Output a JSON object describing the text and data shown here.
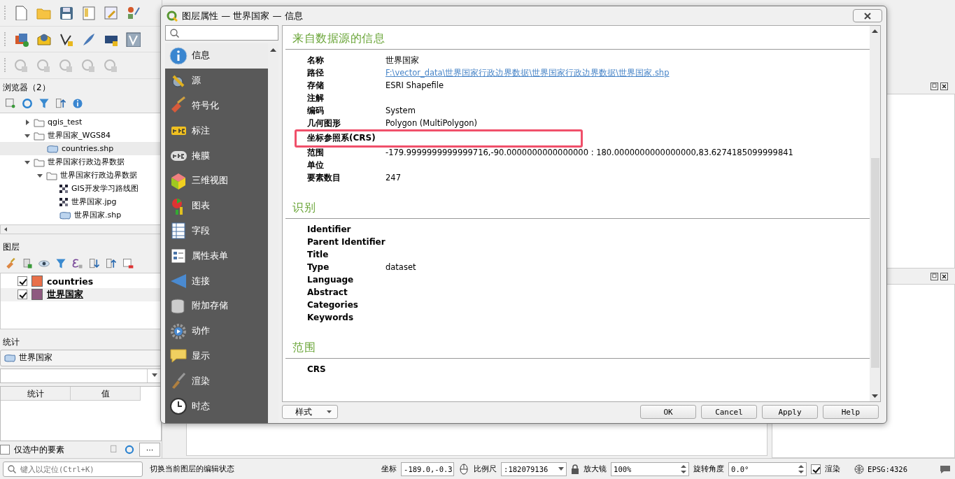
{
  "browser_panel": {
    "title": "浏览器（2）",
    "tree": [
      {
        "label": "qgis_test",
        "kind": "folder",
        "expanded": false,
        "selected": false
      },
      {
        "label": "世界国家_WGS84",
        "kind": "folder",
        "expanded": true,
        "selected": false,
        "children": [
          {
            "label": "countries.shp",
            "kind": "vector",
            "selected": true
          }
        ]
      },
      {
        "label": "世界国家行政边界数据",
        "kind": "folder",
        "expanded": true,
        "selected": false,
        "children": [
          {
            "label": "世界国家行政边界数据",
            "kind": "folder",
            "expanded": true,
            "selected": false,
            "children": [
              {
                "label": "GIS开发学习路线图",
                "kind": "raster",
                "selected": false
              },
              {
                "label": "世界国家.jpg",
                "kind": "raster",
                "selected": false
              },
              {
                "label": "世界国家.shp",
                "kind": "vector",
                "selected": false
              }
            ]
          }
        ]
      }
    ]
  },
  "layers_panel": {
    "title": "图层",
    "layers": [
      {
        "name": "countries",
        "checked": true,
        "color": "#e8704a",
        "selected": false
      },
      {
        "name": "世界国家",
        "checked": true,
        "color": "#8e5a80",
        "selected": true
      }
    ]
  },
  "stats_panel": {
    "title": "统计",
    "layer": "世界国家",
    "columns": [
      "统计",
      "值"
    ],
    "only_selected": {
      "label": "仅选中的要素",
      "checked": false
    },
    "more": "···"
  },
  "locator": {
    "placeholder": "键入以定位(Ctrl+K)"
  },
  "status_bar": {
    "message": "切换当前图层的编辑状态",
    "coordinate_label": "坐标",
    "coordinate": "-189.0,-0.3",
    "scale_label": "比例尺",
    "scale": ":182079136",
    "magnifier_label": "放大镜",
    "magnifier": "100%",
    "rotation_label": "旋转角度",
    "rotation": "0.0°",
    "render": {
      "label": "渲染",
      "checked": true
    },
    "crs": "EPSG:4326"
  },
  "dialog": {
    "title": "图层属性 — 世界国家 — 信息",
    "nav": [
      {
        "label": "信息",
        "selected": true
      },
      {
        "label": "源",
        "selected": false
      },
      {
        "label": "符号化",
        "selected": false
      },
      {
        "label": "标注",
        "selected": false
      },
      {
        "label": "掩膜",
        "selected": false
      },
      {
        "label": "三维视图",
        "selected": false
      },
      {
        "label": "图表",
        "selected": false
      },
      {
        "label": "字段",
        "selected": false
      },
      {
        "label": "属性表单",
        "selected": false
      },
      {
        "label": "连接",
        "selected": false
      },
      {
        "label": "附加存储",
        "selected": false
      },
      {
        "label": "动作",
        "selected": false
      },
      {
        "label": "显示",
        "selected": false
      },
      {
        "label": "渲染",
        "selected": false
      },
      {
        "label": "时态",
        "selected": false
      }
    ],
    "sections": [
      {
        "title": "来自数据源的信息",
        "rows": [
          {
            "label": "名称",
            "value": "世界国家",
            "kind": "text",
            "highlighted": false
          },
          {
            "label": "路径",
            "value": "F:\\vector_data\\世界国家行政边界数据\\世界国家行政边界数据\\世界国家.shp",
            "kind": "link",
            "highlighted": false
          },
          {
            "label": "存储",
            "value": "ESRI Shapefile",
            "kind": "text",
            "highlighted": false
          },
          {
            "label": "注解",
            "value": "",
            "kind": "text",
            "highlighted": false
          },
          {
            "label": "编码",
            "value": "System",
            "kind": "text",
            "highlighted": false
          },
          {
            "label": "几何图形",
            "value": "Polygon (MultiPolygon)",
            "kind": "text",
            "highlighted": false
          },
          {
            "label": "坐标参照系(CRS)",
            "value": "",
            "kind": "text",
            "highlighted": true
          },
          {
            "label": "范围",
            "value": "-179.9999999999999716,-90.0000000000000000 : 180.0000000000000000,83.6274185099999841",
            "kind": "text",
            "highlighted": false
          },
          {
            "label": "单位",
            "value": "",
            "kind": "text",
            "highlighted": false
          },
          {
            "label": "要素数目",
            "value": "247",
            "kind": "text",
            "highlighted": false
          }
        ]
      },
      {
        "title": "识别",
        "rows": [
          {
            "label": "Identifier",
            "value": "",
            "kind": "text",
            "highlighted": false
          },
          {
            "label": "Parent Identifier",
            "value": "",
            "kind": "text",
            "highlighted": false
          },
          {
            "label": "Title",
            "value": "",
            "kind": "text",
            "highlighted": false
          },
          {
            "label": "Type",
            "value": "dataset",
            "kind": "text",
            "highlighted": false
          },
          {
            "label": "Language",
            "value": "",
            "kind": "text",
            "highlighted": false
          },
          {
            "label": "Abstract",
            "value": "",
            "kind": "text",
            "highlighted": false
          },
          {
            "label": "Categories",
            "value": "",
            "kind": "text",
            "highlighted": false
          },
          {
            "label": "Keywords",
            "value": "",
            "kind": "text",
            "highlighted": false
          }
        ]
      },
      {
        "title": "范围",
        "rows": [
          {
            "label": "CRS",
            "value": "",
            "kind": "text",
            "highlighted": false
          }
        ]
      }
    ],
    "style_button": "样式",
    "buttons": [
      "OK",
      "Cancel",
      "Apply",
      "Help"
    ]
  }
}
